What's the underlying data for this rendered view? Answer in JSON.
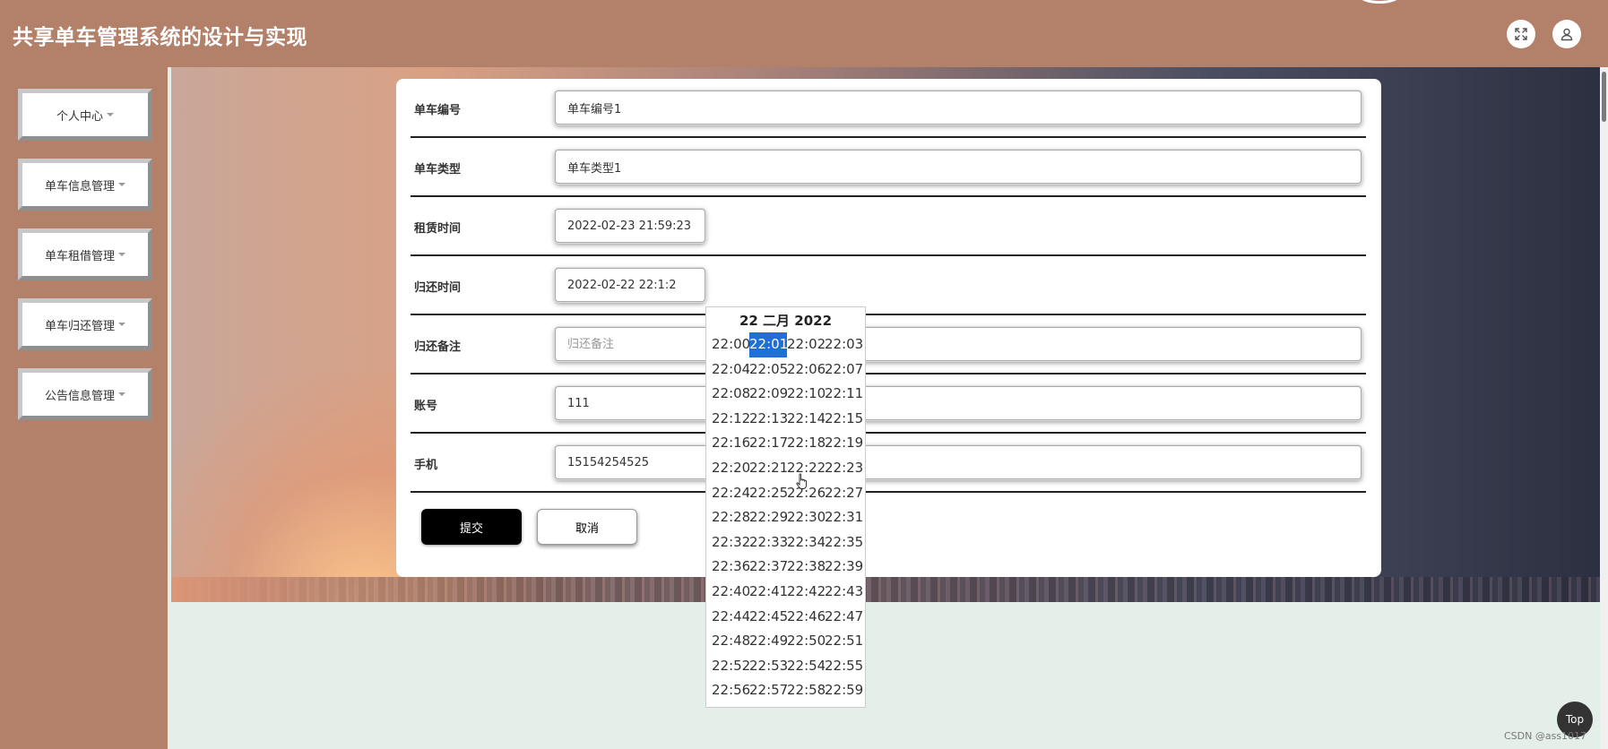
{
  "header": {
    "title": "共享单车管理系统的设计与实现"
  },
  "sidebar": {
    "items": [
      {
        "label": "个人中心"
      },
      {
        "label": "单车信息管理"
      },
      {
        "label": "单车租借管理"
      },
      {
        "label": "单车归还管理"
      },
      {
        "label": "公告信息管理"
      }
    ]
  },
  "form": {
    "bike_no": {
      "label": "单车编号",
      "value": "单车编号1"
    },
    "bike_type": {
      "label": "单车类型",
      "value": "单车类型1"
    },
    "rent_time": {
      "label": "租赁时间",
      "value": "2022-02-23 21:59:23"
    },
    "return_time": {
      "label": "归还时间",
      "value": "2022-02-22 22:1:2"
    },
    "return_note": {
      "label": "归还备注",
      "placeholder": "归还备注"
    },
    "account": {
      "label": "账号",
      "value": "111"
    },
    "phone": {
      "label": "手机",
      "value": "15154254525"
    },
    "submit_label": "提交",
    "cancel_label": "取消"
  },
  "time_picker": {
    "title": "22 二月 2022",
    "selected": "22:01",
    "times": [
      "22:00",
      "22:01",
      "22:02",
      "22:03",
      "22:04",
      "22:05",
      "22:06",
      "22:07",
      "22:08",
      "22:09",
      "22:10",
      "22:11",
      "22:12",
      "22:13",
      "22:14",
      "22:15",
      "22:16",
      "22:17",
      "22:18",
      "22:19",
      "22:20",
      "22:21",
      "22:22",
      "22:23",
      "22:24",
      "22:25",
      "22:26",
      "22:27",
      "22:28",
      "22:29",
      "22:30",
      "22:31",
      "22:32",
      "22:33",
      "22:34",
      "22:35",
      "22:36",
      "22:37",
      "22:38",
      "22:39",
      "22:40",
      "22:41",
      "22:42",
      "22:43",
      "22:44",
      "22:45",
      "22:46",
      "22:47",
      "22:48",
      "22:49",
      "22:50",
      "22:51",
      "22:52",
      "22:53",
      "22:54",
      "22:55",
      "22:56",
      "22:57",
      "22:58",
      "22:59"
    ]
  },
  "top_button_label": "Top",
  "watermark": "CSDN @ass1017"
}
